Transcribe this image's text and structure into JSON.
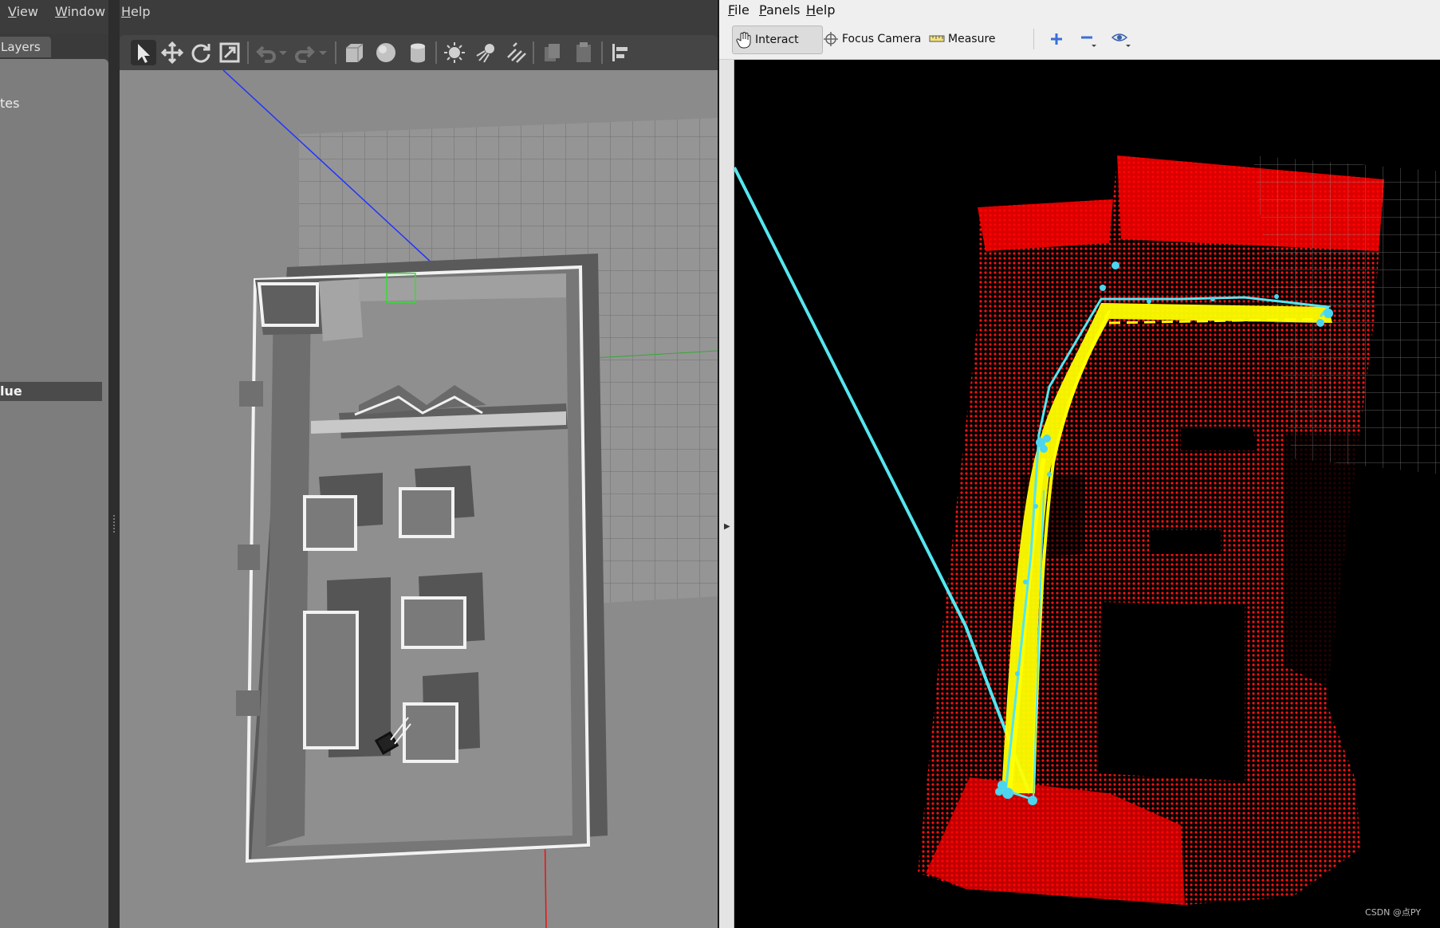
{
  "gazebo": {
    "menu": [
      "View",
      "Window",
      "Help"
    ],
    "panel_tab": "Layers",
    "panel_text_partial": "tes",
    "property_label_partial": "lue",
    "toolbar_icons": [
      "select-mode-icon",
      "translate-mode-icon",
      "rotate-mode-icon",
      "scale-mode-icon",
      "undo-icon",
      "redo-icon",
      "box-shape-icon",
      "sphere-shape-icon",
      "cylinder-shape-icon",
      "point-light-icon",
      "spot-light-icon",
      "directional-light-icon",
      "copy-icon",
      "paste-icon",
      "align-icon"
    ]
  },
  "rviz": {
    "menu": [
      "File",
      "Panels",
      "Help"
    ],
    "tools": [
      {
        "label": "Interact",
        "icon": "hand-icon",
        "active": true
      },
      {
        "label": "Focus Camera",
        "icon": "crosshair-icon",
        "active": false
      },
      {
        "label": "Measure",
        "icon": "ruler-icon",
        "active": false
      }
    ],
    "extra_icons": [
      "add-tool-icon",
      "remove-tool-icon",
      "view-eye-icon"
    ],
    "watermark": "CSDN @点PY",
    "colors": {
      "pointcloud": "#ff0000",
      "path": "#ffff00",
      "trajectory": "#55e6f0",
      "background": "#000000"
    }
  }
}
